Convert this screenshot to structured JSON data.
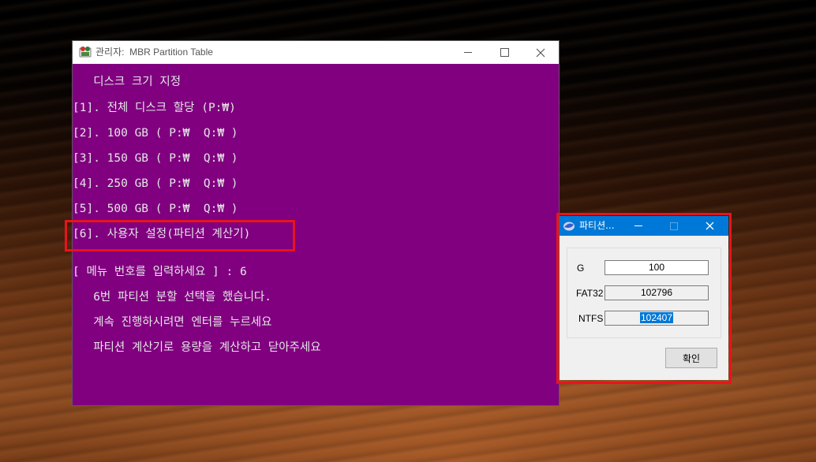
{
  "console": {
    "title": "관리자:  MBR Partition Table",
    "lines": [
      "   디스크 크기 지정",
      "[1]. 전체 디스크 할당 (P:₩)",
      "[2]. 100 GB ( P:₩  Q:₩ )",
      "[3]. 150 GB ( P:₩  Q:₩ )",
      "[4]. 250 GB ( P:₩  Q:₩ )",
      "[5]. 500 GB ( P:₩  Q:₩ )",
      "[6]. 사용자 설정(파티션 계산기)",
      "[ 메뉴 번호를 입력하세요 ] : 6",
      "   6번 파티션 분할 선택을 했습니다.",
      "   계속 진행하시려면 엔터를 누르세요",
      "   파티션 계산기로 용량을 계산하고 닫아주세요"
    ]
  },
  "dialog": {
    "title": "파티션...",
    "fields": {
      "g": {
        "label": "G",
        "value": "100"
      },
      "fat32": {
        "label": "FAT32",
        "value": "102796"
      },
      "ntfs": {
        "label": "NTFS",
        "value": "102407"
      }
    },
    "ok_label": "확인"
  },
  "colors": {
    "console_bg": "#800080",
    "highlight": "#e8141b",
    "dialog_titlebar": "#0078d7"
  }
}
